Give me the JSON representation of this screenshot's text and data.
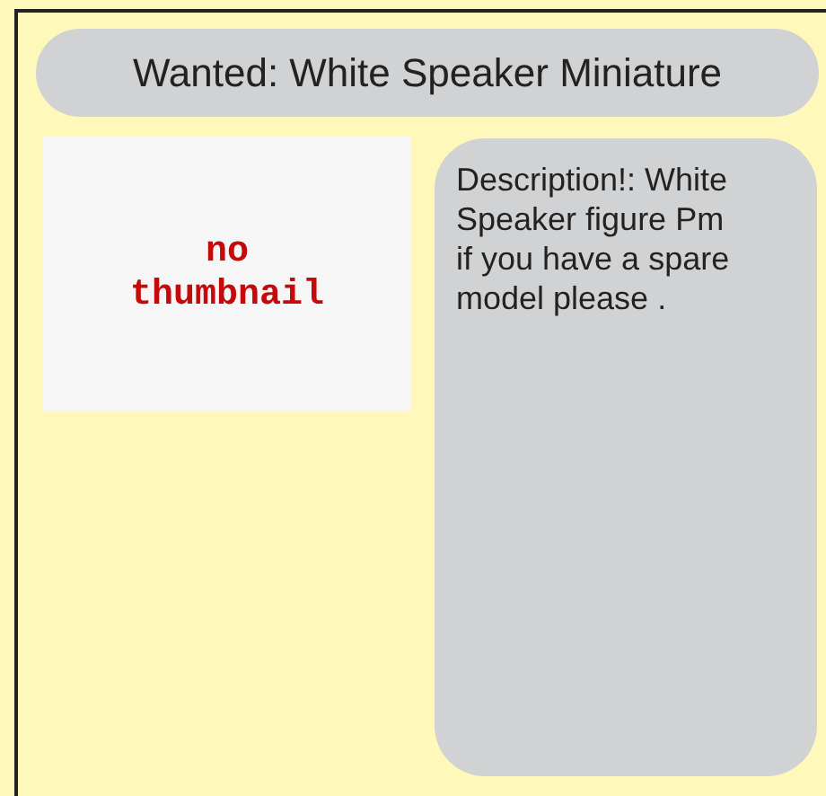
{
  "title": "Wanted: White Speaker Miniature",
  "thumbnail": {
    "text_1": "no",
    "text_2": "thumbnail"
  },
  "description": "Description!: White Speaker figure Pm if you have a spare model please ."
}
